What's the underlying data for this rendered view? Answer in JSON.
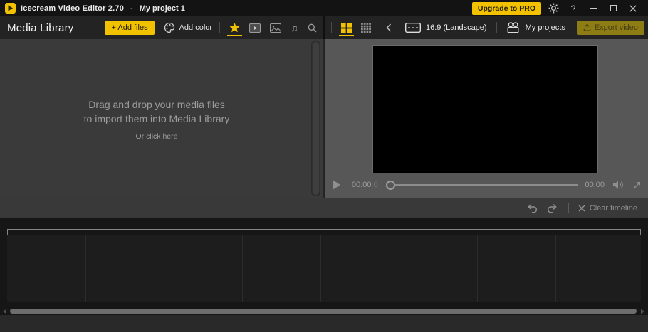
{
  "titlebar": {
    "app_title": "Icecream Video Editor 2.70",
    "title_separator": "-",
    "project_name": "My project 1",
    "upgrade_button": "Upgrade to PRO",
    "help": "?"
  },
  "media_header": {
    "title": "Media Library",
    "add_files_plus": "+",
    "add_files": "Add files",
    "add_color": "Add color"
  },
  "preview_header": {
    "aspect_ratio": "16:9 (Landscape)",
    "my_projects": "My projects",
    "export": "Export video"
  },
  "library": {
    "drop_line1": "Drag and drop your media files",
    "drop_line2": "to import them into Media Library",
    "click_hint": "Or click here"
  },
  "player": {
    "elapsed": "00:00",
    "elapsed_fraction": ".0",
    "duration": "00:00"
  },
  "timeline": {
    "clear_label": "Clear timeline",
    "cells": 9
  },
  "icons": {
    "music_note": "♫"
  },
  "colors": {
    "accent": "#f2c200",
    "export_button_bg": "#8e7c15",
    "titlebar_bg": "#131313",
    "header_bg": "#232323",
    "library_bg": "#3a3a3a",
    "preview_bg": "#575757",
    "toolbar_bg": "#393939",
    "timeline_bg": "#161616"
  }
}
